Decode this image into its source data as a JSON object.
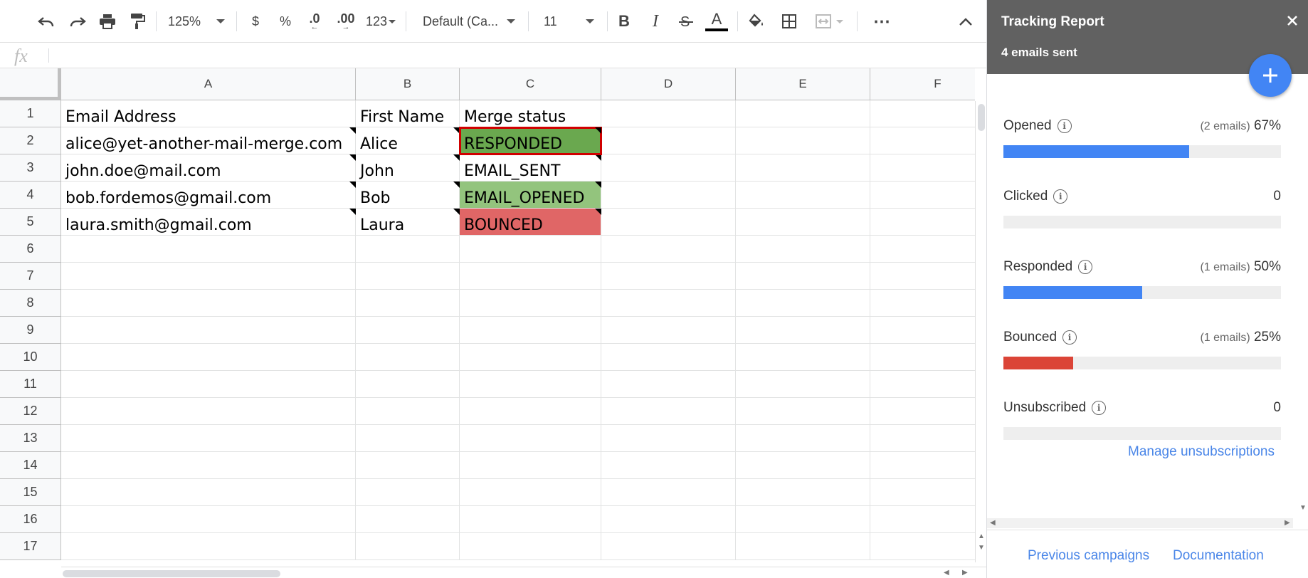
{
  "toolbar": {
    "zoom": "125%",
    "currency": "$",
    "percent": "%",
    "decrease_decimal": ".0",
    "increase_decimal": ".00",
    "number_format": "123",
    "font": "Default (Ca...",
    "font_size": "11",
    "bold": "B",
    "italic": "I",
    "text_color_glyph": "A",
    "text_color": "#000000",
    "more": "⋯"
  },
  "formula_bar": {
    "fx": "fx"
  },
  "sheet": {
    "columns": [
      "A",
      "B",
      "C",
      "D",
      "E",
      "F"
    ],
    "rows": [
      "1",
      "2",
      "3",
      "4",
      "5",
      "6",
      "7",
      "8",
      "9",
      "10",
      "11",
      "12",
      "13",
      "14",
      "15",
      "16",
      "17"
    ],
    "header_row": [
      "Email Address",
      "First Name",
      "Merge status"
    ],
    "data": [
      {
        "email": "alice@yet-another-mail-merge.com",
        "first": "Alice",
        "status": "RESPONDED",
        "status_color": "#6aa84f"
      },
      {
        "email": "john.doe@mail.com",
        "first": "John",
        "status": "EMAIL_SENT",
        "status_color": "#ffffff"
      },
      {
        "email": "bob.fordemos@gmail.com",
        "first": "Bob",
        "status": "EMAIL_OPENED",
        "status_color": "#93c47d"
      },
      {
        "email": "laura.smith@gmail.com",
        "first": "Laura",
        "status": "BOUNCED",
        "status_color": "#e06666"
      }
    ]
  },
  "panel": {
    "title": "Tracking Report",
    "subtitle": "4 emails sent",
    "header_color": "#616161",
    "metrics": [
      {
        "label": "Opened",
        "count": "(2 emails)",
        "value": "67%",
        "fraction": 0.67,
        "color": "#4285f4"
      },
      {
        "label": "Clicked",
        "count": "",
        "value": "0",
        "fraction": 0,
        "color": "#4285f4"
      },
      {
        "label": "Responded",
        "count": "(1 emails)",
        "value": "50%",
        "fraction": 0.5,
        "color": "#4285f4"
      },
      {
        "label": "Bounced",
        "count": "(1 emails)",
        "value": "25%",
        "fraction": 0.25,
        "color": "#db4437"
      },
      {
        "label": "Unsubscribed",
        "count": "",
        "value": "0",
        "fraction": 0,
        "color": "#4285f4"
      }
    ],
    "manage_link": "Manage unsubscriptions",
    "footer_links": [
      "Previous campaigns",
      "Documentation"
    ]
  }
}
